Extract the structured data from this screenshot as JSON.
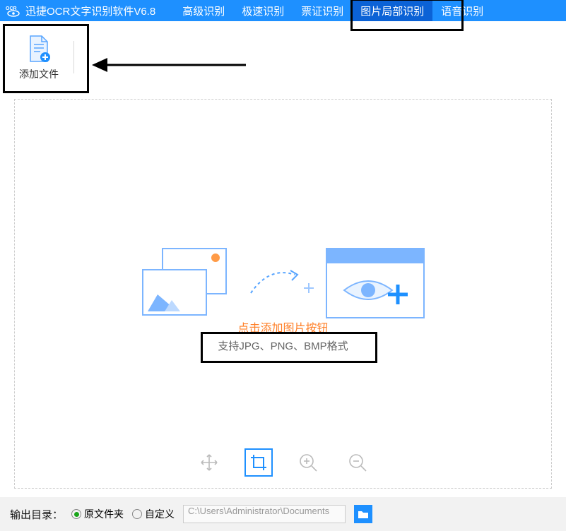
{
  "app": {
    "title": "迅捷OCR文字识别软件V6.8"
  },
  "tabs": {
    "items": [
      {
        "label": "高级识别"
      },
      {
        "label": "极速识别"
      },
      {
        "label": "票证识别"
      },
      {
        "label": "图片局部识别"
      },
      {
        "label": "语音识别"
      }
    ]
  },
  "toolbar": {
    "add_label": "添加文件"
  },
  "canvas": {
    "hint_primary": "点击添加图片按钮",
    "hint_secondary": "支持JPG、PNG、BMP格式"
  },
  "output": {
    "label": "输出目录：",
    "opt_original": "原文件夹",
    "opt_custom": "自定义",
    "path": "C:\\Users\\Administrator\\Documents"
  }
}
